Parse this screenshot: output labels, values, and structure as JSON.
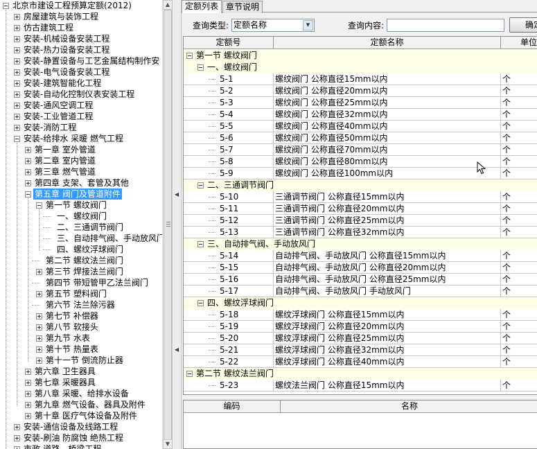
{
  "tree": {
    "items": [
      {
        "label": "北京市建设工程预算定额(2012)",
        "level": 0,
        "expander": "minus"
      },
      {
        "label": "房屋建筑与装饰工程",
        "level": 1,
        "expander": "plus"
      },
      {
        "label": "仿古建筑工程",
        "level": 1,
        "expander": "plus"
      },
      {
        "label": "安装-机械设备安装工程",
        "level": 1,
        "expander": "plus"
      },
      {
        "label": "安装-热力设备安装工程",
        "level": 1,
        "expander": "plus"
      },
      {
        "label": "安装-静置设备与工艺金属结构制作安",
        "level": 1,
        "expander": "plus"
      },
      {
        "label": "安装-电气设备安装工程",
        "level": 1,
        "expander": "plus"
      },
      {
        "label": "安装-建筑智能化工程",
        "level": 1,
        "expander": "plus"
      },
      {
        "label": "安装-自动化控制仪表安装工程",
        "level": 1,
        "expander": "plus"
      },
      {
        "label": "安装-通风空调工程",
        "level": 1,
        "expander": "plus"
      },
      {
        "label": "安装-工业管道工程",
        "level": 1,
        "expander": "plus"
      },
      {
        "label": "安装-消防工程",
        "level": 1,
        "expander": "plus"
      },
      {
        "label": "安装-给排水 采暖 燃气工程",
        "level": 1,
        "expander": "minus"
      },
      {
        "label": "第一章 室外管道",
        "level": 2,
        "expander": "plus"
      },
      {
        "label": "第二章 室内管道",
        "level": 2,
        "expander": "plus"
      },
      {
        "label": "第三章 燃气管道",
        "level": 2,
        "expander": "plus"
      },
      {
        "label": "第四章 支架、套管及其他",
        "level": 2,
        "expander": "plus"
      },
      {
        "label": "第五章 阀门及管道附件",
        "level": 2,
        "expander": "minus",
        "selected": true
      },
      {
        "label": "第一节 螺纹阀门",
        "level": 3,
        "expander": "minus"
      },
      {
        "label": "一、螺纹阀门",
        "level": 4,
        "expander": "none"
      },
      {
        "label": "二、三通调节阀门",
        "level": 4,
        "expander": "none"
      },
      {
        "label": "三、自动排气阀、手动放风门",
        "level": 4,
        "expander": "none"
      },
      {
        "label": "四、螺纹浮球阀门",
        "level": 4,
        "expander": "none"
      },
      {
        "label": "第二节 螺纹法兰阀门",
        "level": 3,
        "expander": "none"
      },
      {
        "label": "第三节 焊接法兰阀门",
        "level": 3,
        "expander": "plus"
      },
      {
        "label": "第四节 带短管甲乙法兰阀门",
        "level": 3,
        "expander": "none"
      },
      {
        "label": "第五节 塑料阀门",
        "level": 3,
        "expander": "plus"
      },
      {
        "label": "第六节 法兰除污器",
        "level": 3,
        "expander": "none"
      },
      {
        "label": "第七节 补偿器",
        "level": 3,
        "expander": "plus"
      },
      {
        "label": "第八节 软接头",
        "level": 3,
        "expander": "plus"
      },
      {
        "label": "第九节 水表",
        "level": 3,
        "expander": "plus"
      },
      {
        "label": "第十节 热量表",
        "level": 3,
        "expander": "plus"
      },
      {
        "label": "第十一节 倒流防止器",
        "level": 3,
        "expander": "plus"
      },
      {
        "label": "第六章 卫生器具",
        "level": 2,
        "expander": "plus"
      },
      {
        "label": "第七章 采暖器具",
        "level": 2,
        "expander": "plus"
      },
      {
        "label": "第八章 采暖、给排水设备",
        "level": 2,
        "expander": "plus"
      },
      {
        "label": "第九章 燃气设备、器具及附件",
        "level": 2,
        "expander": "plus"
      },
      {
        "label": "第十章 医疗气体设备及附件",
        "level": 2,
        "expander": "plus"
      },
      {
        "label": "安装-通信设备及线路工程",
        "level": 1,
        "expander": "plus"
      },
      {
        "label": "安装-刷油 防腐蚀 绝热工程",
        "level": 1,
        "expander": "plus"
      },
      {
        "label": "市政-道路、桥梁工程",
        "level": 1,
        "expander": "plus"
      }
    ]
  },
  "tabs": [
    {
      "label": "定额列表",
      "active": true
    },
    {
      "label": "章节说明",
      "active": false
    }
  ],
  "query": {
    "type_label": "查询类型:",
    "type_value": "定额名称",
    "content_label": "查询内容:",
    "content_value": "",
    "confirm_label": "确定"
  },
  "grid": {
    "columns": [
      "定额号",
      "定额名称",
      "单位"
    ],
    "rows": [
      {
        "kind": "section",
        "label": "第一节 螺纹阀门"
      },
      {
        "kind": "subsection",
        "label": "一、螺纹阀门"
      },
      {
        "kind": "item",
        "code": "5-1",
        "name": "螺纹阀门 公称直径15mm以内",
        "unit": "个"
      },
      {
        "kind": "item",
        "code": "5-2",
        "name": "螺纹阀门 公称直径20mm以内",
        "unit": "个"
      },
      {
        "kind": "item",
        "code": "5-3",
        "name": "螺纹阀门 公称直径25mm以内",
        "unit": "个"
      },
      {
        "kind": "item",
        "code": "5-4",
        "name": "螺纹阀门 公称直径32mm以内",
        "unit": "个"
      },
      {
        "kind": "item",
        "code": "5-5",
        "name": "螺纹阀门 公称直径40mm以内",
        "unit": "个"
      },
      {
        "kind": "item",
        "code": "5-6",
        "name": "螺纹阀门 公称直径50mm以内",
        "unit": "个"
      },
      {
        "kind": "item",
        "code": "5-7",
        "name": "螺纹阀门 公称直径70mm以内",
        "unit": "个"
      },
      {
        "kind": "item",
        "code": "5-8",
        "name": "螺纹阀门 公称直径80mm以内",
        "unit": "个"
      },
      {
        "kind": "item",
        "code": "5-9",
        "name": "螺纹阀门 公称直径100mm以内",
        "unit": "个"
      },
      {
        "kind": "subsection",
        "label": "二、三通调节阀门"
      },
      {
        "kind": "item",
        "code": "5-10",
        "name": "三通调节阀门 公称直径15mm以内",
        "unit": "个"
      },
      {
        "kind": "item",
        "code": "5-11",
        "name": "三通调节阀门 公称直径20mm以内",
        "unit": "个"
      },
      {
        "kind": "item",
        "code": "5-12",
        "name": "三通调节阀门 公称直径25mm以内",
        "unit": "个"
      },
      {
        "kind": "item",
        "code": "5-13",
        "name": "三通调节阀门 公称直径32mm以内",
        "unit": "个"
      },
      {
        "kind": "subsection",
        "label": "三、自动排气阀、手动放风门"
      },
      {
        "kind": "item",
        "code": "5-14",
        "name": "自动排气阀、手动放风门 公称直径15mm以内",
        "unit": "个"
      },
      {
        "kind": "item",
        "code": "5-15",
        "name": "自动排气阀、手动放风门 公称直径20mm以内",
        "unit": "个"
      },
      {
        "kind": "item",
        "code": "5-16",
        "name": "自动排气阀、手动放风门 公称直径25mm以内",
        "unit": "个"
      },
      {
        "kind": "item",
        "code": "5-17",
        "name": "自动排气阀、手动放风门 手动放风门",
        "unit": "个"
      },
      {
        "kind": "subsection",
        "label": "四、螺纹浮球阀门"
      },
      {
        "kind": "item",
        "code": "5-18",
        "name": "螺纹浮球阀门 公称直径15mm以内",
        "unit": "个"
      },
      {
        "kind": "item",
        "code": "5-19",
        "name": "螺纹浮球阀门 公称直径20mm以内",
        "unit": "个"
      },
      {
        "kind": "item",
        "code": "5-20",
        "name": "螺纹浮球阀门 公称直径25mm以内",
        "unit": "个"
      },
      {
        "kind": "item",
        "code": "5-21",
        "name": "螺纹浮球阀门 公称直径32mm以内",
        "unit": "个"
      },
      {
        "kind": "item",
        "code": "5-22",
        "name": "螺纹浮球阀门 公称直径40mm以内",
        "unit": "个"
      },
      {
        "kind": "section",
        "label": "第二节 螺纹法兰阀门"
      },
      {
        "kind": "item",
        "code": "5-23",
        "name": "螺纹法兰阀门 公称直径15mm以内",
        "unit": "个"
      }
    ]
  },
  "detail_grid": {
    "columns": [
      "编码",
      "名称"
    ]
  },
  "colors": {
    "selection": "#3399ff",
    "group_row_bg": "#ffffe7"
  }
}
